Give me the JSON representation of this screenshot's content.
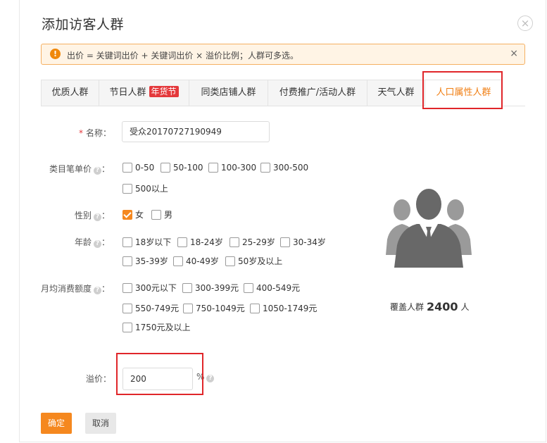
{
  "dialog": {
    "title": "添加访客人群",
    "close_glyph": "×"
  },
  "alert": {
    "icon_glyph": "!",
    "text": "出价 = 关键词出价 + 关键词出价 × 溢价比例；人群可多选。",
    "close_glyph": "×"
  },
  "tabs": [
    {
      "label": "优质人群"
    },
    {
      "label": "节日人群",
      "tag": "年货节"
    },
    {
      "label": "同类店铺人群"
    },
    {
      "label": "付费推广/活动人群"
    },
    {
      "label": "天气人群"
    },
    {
      "label": "人口属性人群",
      "active": true
    }
  ],
  "form": {
    "name_label": "名称：",
    "required_mark": "*",
    "name_value": "受众20170727190949",
    "price_label": "类目笔单价",
    "price_options": [
      "0-50",
      "50-100",
      "100-300",
      "300-500",
      "500以上"
    ],
    "gender_label": "性别",
    "gender_options": [
      "女",
      "男"
    ],
    "age_label": "年龄",
    "age_options": [
      "18岁以下",
      "18-24岁",
      "25-29岁",
      "30-34岁",
      "35-39岁",
      "40-49岁",
      "50岁及以上"
    ],
    "spend_label": "月均消费额度",
    "spend_options": [
      "300元以下",
      "300-399元",
      "400-549元",
      "550-749元",
      "750-1049元",
      "1050-1749元",
      "1750元及以上"
    ],
    "help_glyph": "?",
    "label_colon": "：",
    "premium_label": "溢价：",
    "premium_value": "200",
    "premium_unit": "%"
  },
  "coverage": {
    "prefix": "覆盖人群",
    "count": "2400",
    "suffix": "人"
  },
  "buttons": {
    "ok": "确定",
    "cancel": "取消"
  },
  "colors": {
    "accent": "#f5881f",
    "highlight": "#e0262a",
    "alert_bg": "#fff4e5"
  }
}
